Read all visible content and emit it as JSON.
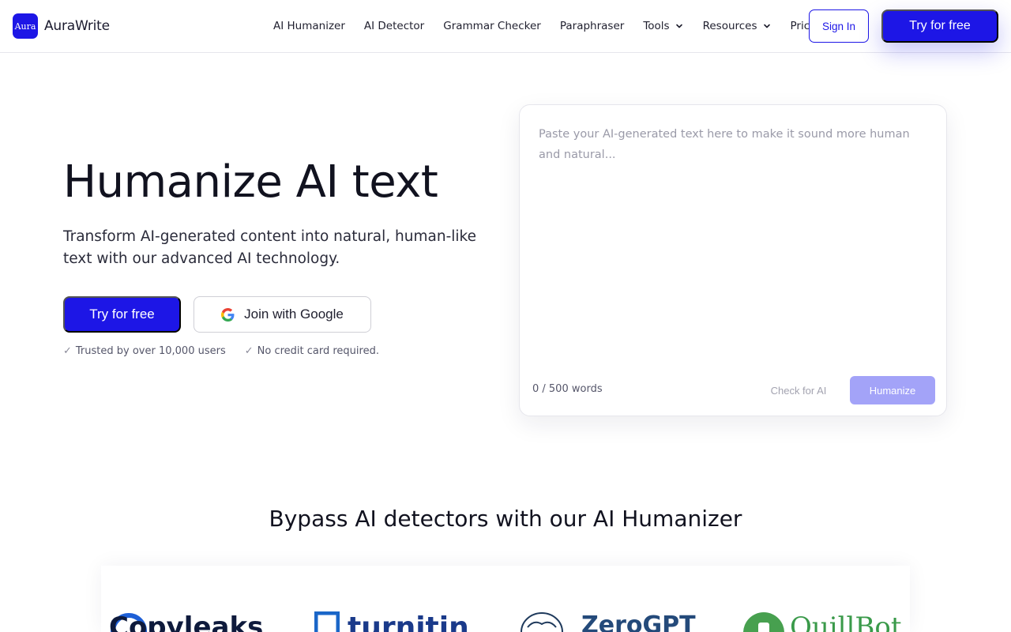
{
  "brand": {
    "logo_mark": "Aura",
    "name": "AuraWrite",
    "primary_color": "#1d16e6"
  },
  "nav": {
    "items": [
      {
        "label": "AI Humanizer",
        "dropdown": false
      },
      {
        "label": "AI Detector",
        "dropdown": false
      },
      {
        "label": "Grammar Checker",
        "dropdown": false
      },
      {
        "label": "Paraphraser",
        "dropdown": false
      },
      {
        "label": "Tools",
        "dropdown": true
      },
      {
        "label": "Resources",
        "dropdown": true
      },
      {
        "label": "Pricing",
        "dropdown": false
      }
    ],
    "sign_in": "Sign In",
    "try_free": "Try for free"
  },
  "hero": {
    "title": "Humanize AI text",
    "subtitle": "Transform AI-generated content into natural, human-like text with our advanced AI technology.",
    "try_free": "Try for free",
    "google": "Join with Google",
    "trust": [
      {
        "check": "✓",
        "text": "Trusted by over 10,000 users"
      },
      {
        "check": "✓",
        "text": "No credit card required."
      }
    ]
  },
  "editor": {
    "placeholder": "Paste your AI-generated text here to make it sound more human and natural...",
    "value": "",
    "word_count": "0 / 500 words",
    "check_label": "Check for AI",
    "humanize_label": "Humanize"
  },
  "bypass": {
    "title": "Bypass AI detectors with our AI Humanizer",
    "logos": [
      "Copyleaks",
      "turnitin",
      "ZeroGPT",
      "QuillBot"
    ]
  }
}
